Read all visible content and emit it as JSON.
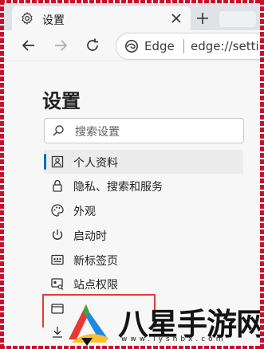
{
  "tab": {
    "title": "设置",
    "icon": "gear-icon",
    "close_icon": "close-icon"
  },
  "toolbar": {
    "back_icon": "back-arrow-icon",
    "forward_icon": "forward-arrow-icon",
    "refresh_icon": "refresh-icon",
    "newtab_icon": "plus-icon"
  },
  "address": {
    "brand": "Edge",
    "url": "edge://settings/profiles"
  },
  "settings": {
    "title": "设置",
    "search_placeholder": "搜索设置",
    "nav": [
      {
        "label": "个人资料",
        "icon": "profile-icon",
        "active": true
      },
      {
        "label": "隐私、搜索和服务",
        "icon": "lock-icon",
        "active": false
      },
      {
        "label": "外观",
        "icon": "palette-icon",
        "active": false
      },
      {
        "label": "启动时",
        "icon": "power-icon",
        "active": false
      },
      {
        "label": "新标签页",
        "icon": "new-tab-page-icon",
        "active": false
      },
      {
        "label": "站点权限",
        "icon": "site-permissions-icon",
        "active": false
      }
    ]
  },
  "colors": {
    "accent": "#0f6cbd",
    "frame": "#c8102e",
    "highlight": "#e53935"
  },
  "watermark": {
    "title": "八星手游网",
    "subtitle": "www.lyshbx.com"
  }
}
